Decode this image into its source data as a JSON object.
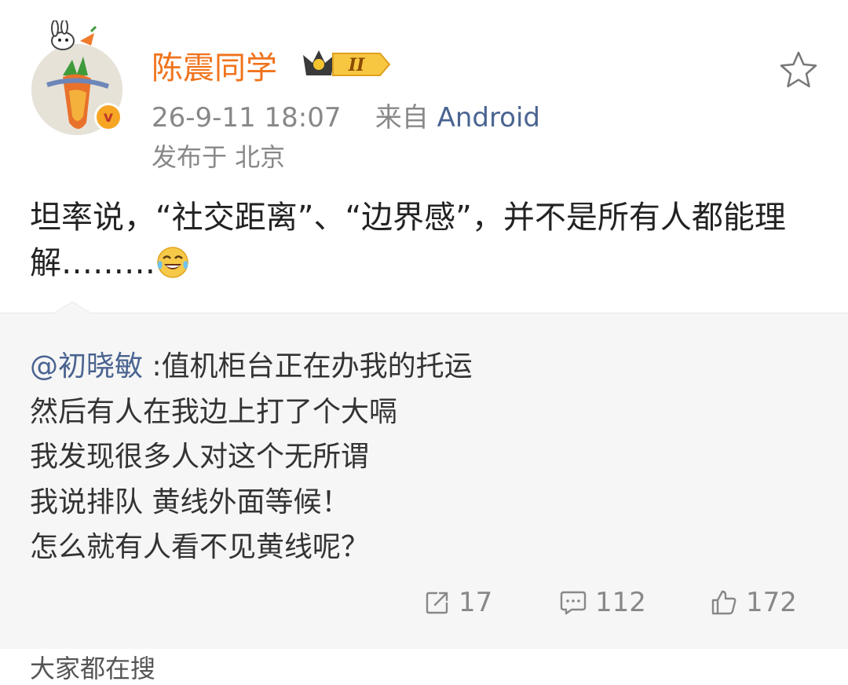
{
  "post": {
    "username": "陈震同学",
    "badge_level": "II",
    "timestamp": "26-9-11 18:07",
    "source_prefix": "来自",
    "source": "Android",
    "location": "发布于 北京",
    "text": "坦率说，“社交距离”、“边界感”，并不是所有人都能理解………"
  },
  "repost": {
    "mention": "@初晓敏",
    "lines": [
      ":值机柜台正在办我的托运",
      "然后有人在我边上打了个大嗝",
      "我发现很多人对这个无所谓",
      "我说排队 黄线外面等候！",
      "怎么就有人看不见黄线呢？"
    ]
  },
  "actions": {
    "share_count": "17",
    "comment_count": "112",
    "like_count": "172"
  },
  "next_item_peek": "大家都在搜",
  "colors": {
    "username": "#f0731c",
    "link": "#4a6491",
    "meta": "#888888",
    "repost_bg": "#f6f6f6"
  },
  "icons": [
    "star-icon",
    "share-icon",
    "comment-icon",
    "like-icon",
    "verified-icon",
    "crown-badge-icon",
    "laugh-cry-emoji"
  ]
}
